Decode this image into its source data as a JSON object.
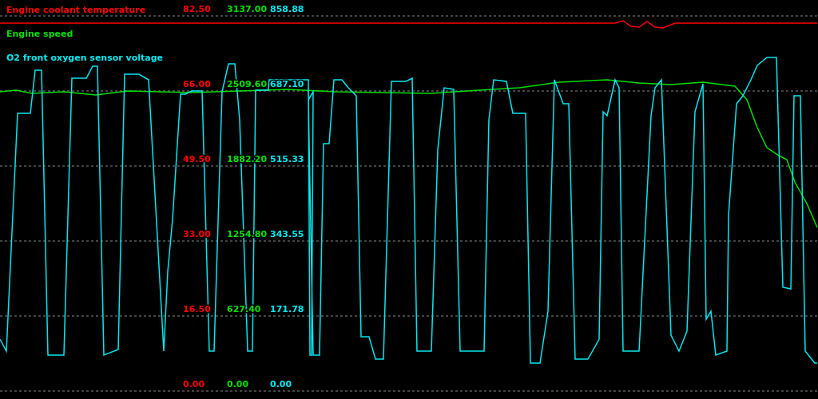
{
  "series": [
    {
      "name": "Engine coolant temperature",
      "color": "#ff0000",
      "tick_labels": [
        "82.50",
        "66.00",
        "49.50",
        "33.00",
        "16.50",
        "0.00"
      ]
    },
    {
      "name": "Engine speed",
      "color": "#00e000",
      "tick_labels": [
        "3137.00",
        "2509.60",
        "1882.20",
        "1254.80",
        "627.40",
        "0.00"
      ]
    },
    {
      "name": "O2 front oxygen sensor voltage",
      "color": "#00e8f0",
      "tick_labels": [
        "858.88",
        "687.10",
        "515.33",
        "343.55",
        "171.78",
        "0.00"
      ]
    }
  ]
}
